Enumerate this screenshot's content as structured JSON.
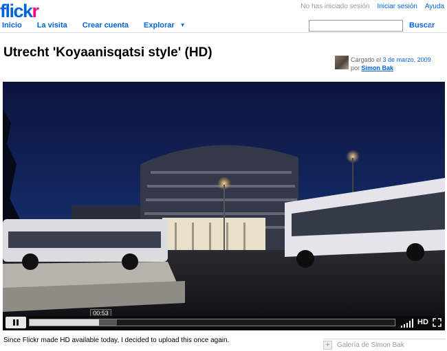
{
  "header": {
    "logo_part1": "flick",
    "logo_part2": "r",
    "signed_out_text": "No has iniciado sesión",
    "signin_link": "Iniciar sesión",
    "help_link": "Ayuda"
  },
  "nav": {
    "items": [
      "Inicio",
      "La visita",
      "Crear cuenta",
      "Explorar"
    ],
    "explore_has_dropdown": true
  },
  "search": {
    "value": "",
    "button_label": "Buscar"
  },
  "photo": {
    "title": "Utrecht 'Koyaanisqatsi style' (HD)",
    "uploaded_prefix": "Cargado el",
    "date": "3 de marzo, 2009",
    "by_prefix": "por",
    "user": "Simon Bak",
    "description": "Since Flickr made HD available today, I decided to upload this once again."
  },
  "player": {
    "time_tooltip": "00:53",
    "played_fraction": 0.19,
    "buffered_fraction": 0.24,
    "hd_label": "HD",
    "state": "playing"
  },
  "sidebar": {
    "gallery_label": "Galería de Simon Bak"
  },
  "colors": {
    "brand_blue": "#0063dc",
    "brand_pink": "#ff0084"
  },
  "icons": {
    "pause": "pause-icon",
    "volume": "volume-icon",
    "fullscreen": "fullscreen-icon",
    "gallery": "plus-icon"
  }
}
